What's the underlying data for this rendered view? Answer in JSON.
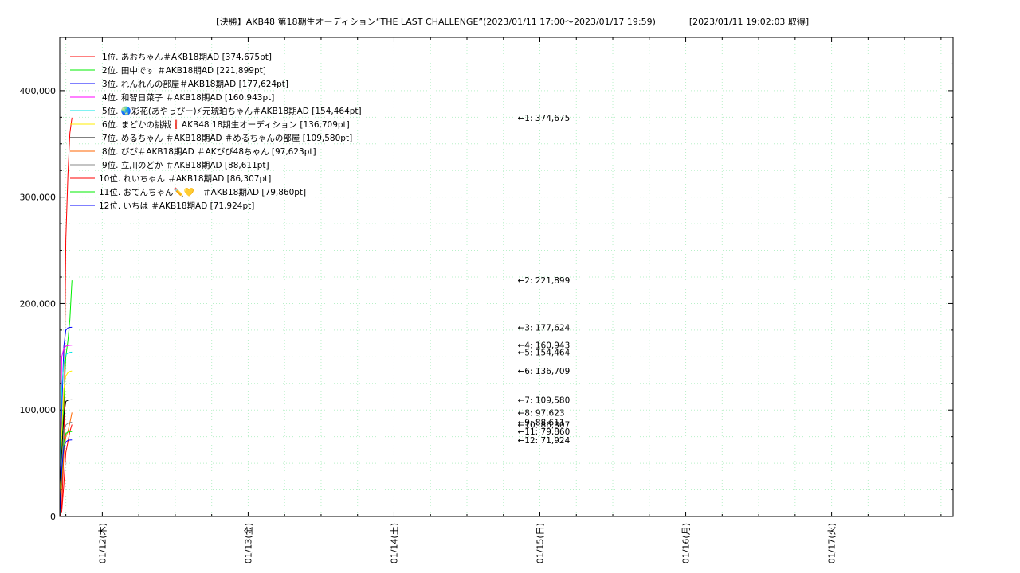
{
  "chart_data": {
    "type": "line",
    "title": "【決勝】AKB48 第18期生オーディション“THE LAST CHALLENGE”(2023/01/11 17:00〜2023/01/17 19:59)",
    "retrieved": "[2023/01/11 19:02:03 取得]",
    "xlabel": "",
    "ylabel": "",
    "ylim": [
      0,
      450000
    ],
    "xlim": [
      "2023-01-11 17:00",
      "2023-01-17 19:59"
    ],
    "grid": true,
    "legend_position": "top-left",
    "y_tick_labels": [
      {
        "value": 0,
        "label": "0"
      },
      {
        "value": 100000,
        "label": "100,000"
      },
      {
        "value": 200000,
        "label": "200,000"
      },
      {
        "value": 300000,
        "label": "300,000"
      },
      {
        "value": 400000,
        "label": "400,000"
      }
    ],
    "x_tick_labels": [
      {
        "value": "2023-01-12 00:00",
        "label": "01/12(木)"
      },
      {
        "value": "2023-01-13 00:00",
        "label": "01/13(金)"
      },
      {
        "value": "2023-01-14 00:00",
        "label": "01/14(土)"
      },
      {
        "value": "2023-01-15 00:00",
        "label": "01/15(日)"
      },
      {
        "value": "2023-01-16 00:00",
        "label": "01/16(月)"
      },
      {
        "value": "2023-01-17 00:00",
        "label": "01/17(火)"
      }
    ],
    "annotation_time": "2023-01-15 00:00",
    "series": [
      {
        "name": "1位. あおちゃん＃AKB18期AD [374,675pt]",
        "color": "#ff0000",
        "annotation": "←1: 374,675",
        "x": [
          "2023-01-11 17:00",
          "2023-01-11 17:20",
          "2023-01-11 17:40",
          "2023-01-11 18:00",
          "2023-01-11 18:20",
          "2023-01-11 18:40",
          "2023-01-11 19:00"
        ],
        "y": [
          0,
          10000,
          60000,
          260000,
          320000,
          360000,
          374675
        ]
      },
      {
        "name": "2位. 田中です ＃AKB18期AD [221,899pt]",
        "color": "#00ee00",
        "annotation": "←2: 221,899",
        "x": [
          "2023-01-11 17:00",
          "2023-01-11 17:20",
          "2023-01-11 17:40",
          "2023-01-11 18:00",
          "2023-01-11 18:20",
          "2023-01-11 18:40",
          "2023-01-11 19:00"
        ],
        "y": [
          0,
          60000,
          110000,
          150000,
          165000,
          185000,
          221899
        ]
      },
      {
        "name": "3位. れんれんの部屋＃AKB18期AD [177,624pt]",
        "color": "#0000ff",
        "annotation": "←3: 177,624",
        "x": [
          "2023-01-11 17:00",
          "2023-01-11 17:20",
          "2023-01-11 17:40",
          "2023-01-11 18:00",
          "2023-01-11 18:20",
          "2023-01-11 18:40",
          "2023-01-11 19:00"
        ],
        "y": [
          20000,
          100000,
          160000,
          175000,
          177000,
          177500,
          177624
        ]
      },
      {
        "name": "4位. 和智日菜子 ＃AKB18期AD [160,943pt]",
        "color": "#ff00ff",
        "annotation": "←4: 160,943",
        "x": [
          "2023-01-11 17:00",
          "2023-01-11 17:20",
          "2023-01-11 17:40",
          "2023-01-11 18:00",
          "2023-01-11 18:20",
          "2023-01-11 18:40",
          "2023-01-11 19:00"
        ],
        "y": [
          30000,
          150000,
          158000,
          160000,
          160500,
          160800,
          160943
        ]
      },
      {
        "name": "5位. 🌏彩花(あやっぴー)⚡元琥珀ちゃん＃AKB18期AD [154,464pt]",
        "color": "#00e5e5",
        "annotation": "←5: 154,464",
        "x": [
          "2023-01-11 17:00",
          "2023-01-11 17:20",
          "2023-01-11 17:40",
          "2023-01-11 18:00",
          "2023-01-11 18:20",
          "2023-01-11 18:40",
          "2023-01-11 19:00"
        ],
        "y": [
          40000,
          120000,
          145000,
          152000,
          153500,
          154200,
          154464
        ]
      },
      {
        "name": "6位. まどかの挑戦❗AKB48 18期生オーディション [136,709pt]",
        "color": "#ffee00",
        "annotation": "←6: 136,709",
        "x": [
          "2023-01-11 17:00",
          "2023-01-11 17:20",
          "2023-01-11 17:40",
          "2023-01-11 18:00",
          "2023-01-11 18:20",
          "2023-01-11 18:40",
          "2023-01-11 19:00"
        ],
        "y": [
          0,
          80000,
          120000,
          132000,
          135000,
          136300,
          136709
        ]
      },
      {
        "name": "7位. めるちゃん ＃AKB18期AD ＃めるちゃんの部屋 [109,580pt]",
        "color": "#000000",
        "annotation": "←7: 109,580",
        "x": [
          "2023-01-11 17:00",
          "2023-01-11 17:20",
          "2023-01-11 17:40",
          "2023-01-11 18:00",
          "2023-01-11 18:20",
          "2023-01-11 18:40",
          "2023-01-11 19:00"
        ],
        "y": [
          30000,
          60000,
          95000,
          108000,
          109200,
          109500,
          109580
        ]
      },
      {
        "name": "8位. びび＃AKB18期AD ＃AKびび48ちゃん [97,623pt]",
        "color": "#ff6600",
        "annotation": "←8: 97,623",
        "x": [
          "2023-01-11 17:00",
          "2023-01-11 17:20",
          "2023-01-11 17:40",
          "2023-01-11 18:00",
          "2023-01-11 18:20",
          "2023-01-11 18:40",
          "2023-01-11 19:00"
        ],
        "y": [
          0,
          30000,
          60000,
          75000,
          80000,
          88000,
          97623
        ]
      },
      {
        "name": "9位. 立川のどか ＃AKB18期AD [88,611pt]",
        "color": "#888888",
        "annotation": "←9: 88,611",
        "x": [
          "2023-01-11 17:00",
          "2023-01-11 17:20",
          "2023-01-11 17:40",
          "2023-01-11 18:00",
          "2023-01-11 18:20",
          "2023-01-11 18:40",
          "2023-01-11 19:00"
        ],
        "y": [
          0,
          50000,
          80000,
          86000,
          87500,
          88300,
          88611
        ]
      },
      {
        "name": "10位. れいちゃん ＃AKB18期AD [86,307pt]",
        "color": "#ff0000",
        "annotation": "←10: 86,307",
        "x": [
          "2023-01-11 17:00",
          "2023-01-11 17:20",
          "2023-01-11 17:40",
          "2023-01-11 18:00",
          "2023-01-11 18:20",
          "2023-01-11 18:40",
          "2023-01-11 19:00"
        ],
        "y": [
          0,
          5000,
          30000,
          60000,
          70000,
          80000,
          86307
        ]
      },
      {
        "name": "11位. おてんちゃん✏️💛　＃AKB18期AD [79,860pt]",
        "color": "#00ee00",
        "annotation": "←11: 79,860",
        "x": [
          "2023-01-11 17:00",
          "2023-01-11 17:20",
          "2023-01-11 17:40",
          "2023-01-11 18:00",
          "2023-01-11 18:20",
          "2023-01-11 18:40",
          "2023-01-11 19:00"
        ],
        "y": [
          0,
          40000,
          70000,
          78000,
          79300,
          79700,
          79860
        ]
      },
      {
        "name": "12位. いちは ＃AKB18期AD [71,924pt]",
        "color": "#0000ff",
        "annotation": "←12: 71,924",
        "x": [
          "2023-01-11 17:00",
          "2023-01-11 17:20",
          "2023-01-11 17:40",
          "2023-01-11 18:00",
          "2023-01-11 18:20",
          "2023-01-11 18:40",
          "2023-01-11 19:00"
        ],
        "y": [
          0,
          45000,
          65000,
          70000,
          71500,
          71800,
          71924
        ]
      }
    ]
  }
}
